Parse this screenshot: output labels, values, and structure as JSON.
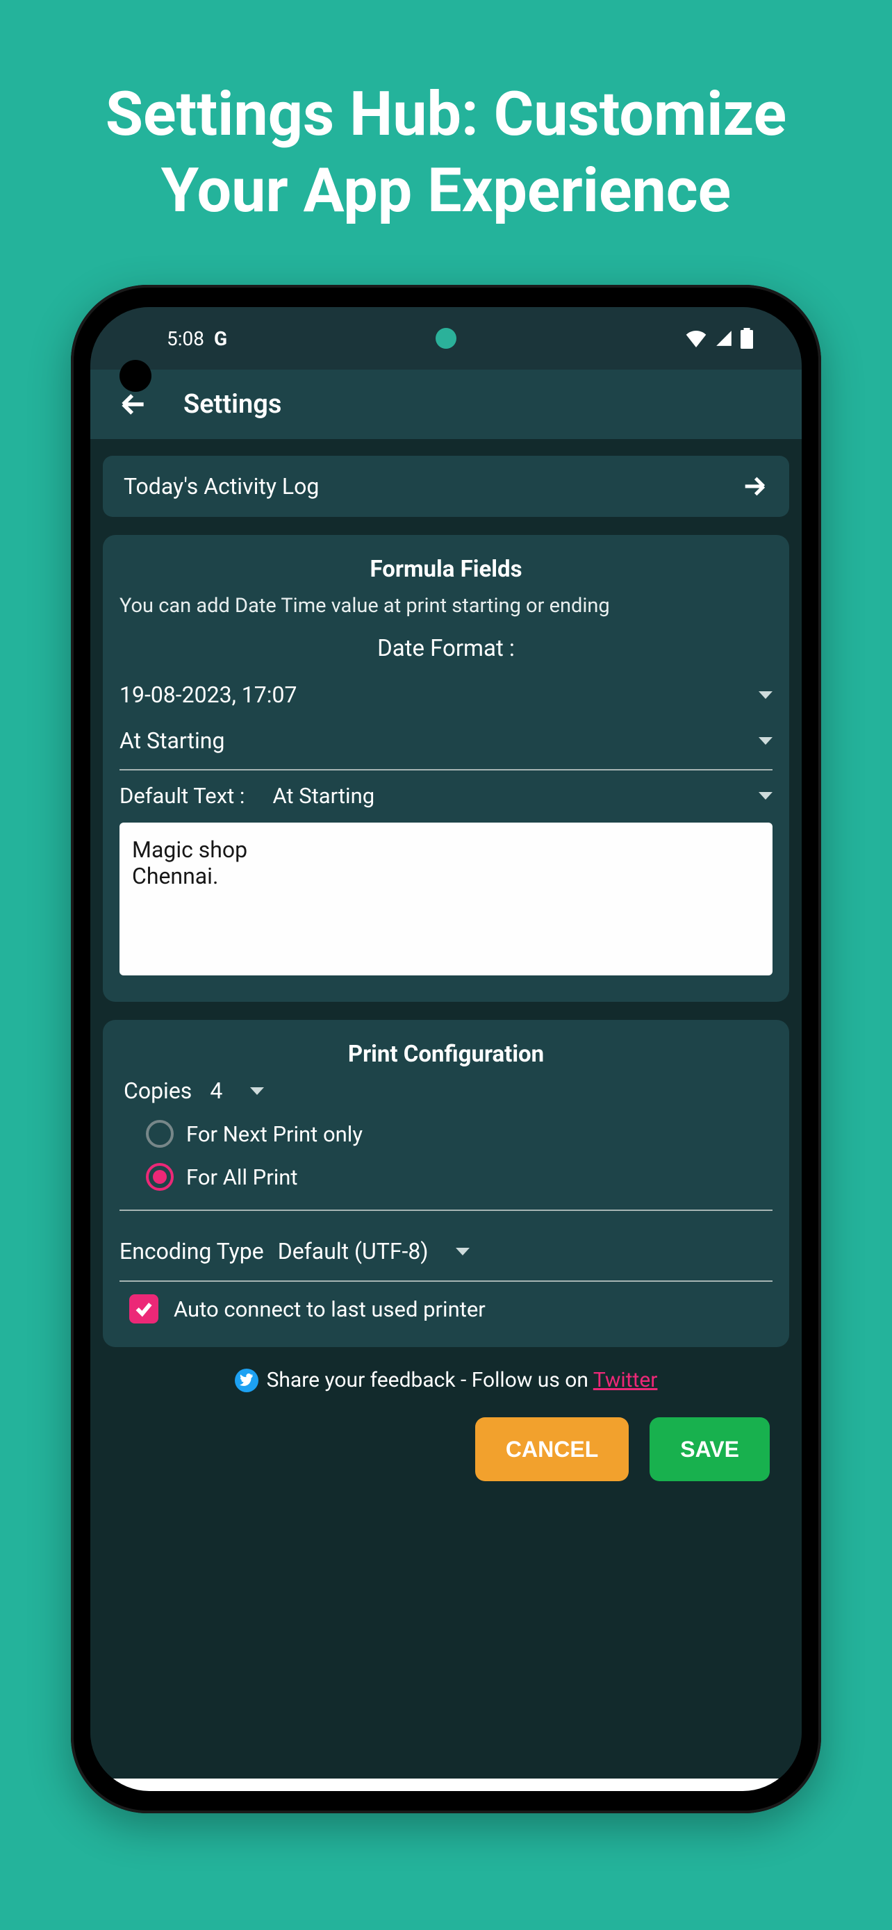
{
  "marketing": {
    "title": "Settings Hub: Customize Your App Experience"
  },
  "status": {
    "time": "5:08",
    "google_badge": "G"
  },
  "appbar": {
    "title": "Settings"
  },
  "activity": {
    "label": "Today's Activity Log"
  },
  "formula": {
    "title": "Formula Fields",
    "description": "You can add Date Time value at print starting or ending",
    "date_format_label": "Date Format :",
    "date_value": "19-08-2023, 17:07",
    "position_value": "At Starting",
    "default_text_label": "Default Text :",
    "default_text_position": "At Starting",
    "default_text_value": "Magic shop\nChennai."
  },
  "print_config": {
    "title": "Print Configuration",
    "copies_label": "Copies",
    "copies_value": "4",
    "radio_next_only": "For Next Print only",
    "radio_all": "For All Print",
    "encoding_label": "Encoding Type",
    "encoding_value": "Default (UTF-8)",
    "auto_connect_label": "Auto connect to last used printer"
  },
  "feedback": {
    "text": "Share your feedback - Follow us on ",
    "link_label": "Twitter"
  },
  "footer": {
    "cancel": "CANCEL",
    "save": "SAVE"
  }
}
